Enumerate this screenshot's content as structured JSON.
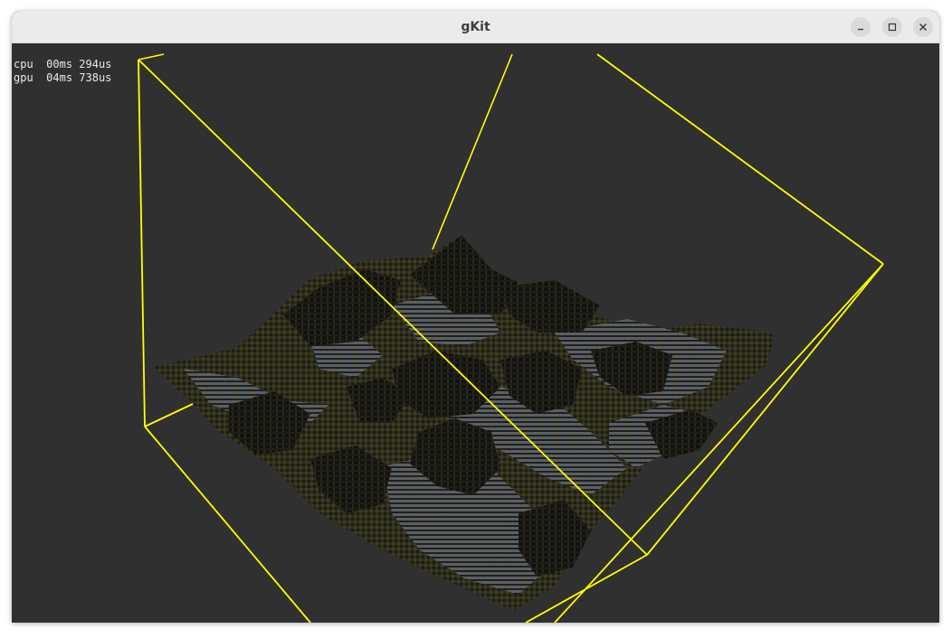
{
  "window": {
    "title": "gKit",
    "minimize_glyph": "minimize-icon",
    "maximize_glyph": "maximize-icon",
    "close_glyph": "close-icon"
  },
  "stats": {
    "cpu_label": "cpu",
    "cpu_value": "00ms 294us",
    "gpu_label": "gpu",
    "gpu_value": "04ms 738us"
  },
  "scene": {
    "description_colors": {
      "background": "#303030",
      "bounding_box": "#ffff00",
      "terrain_dark": "#141410",
      "terrain_grass": "#3b3a22",
      "terrain_rock": "#5b6670"
    }
  }
}
